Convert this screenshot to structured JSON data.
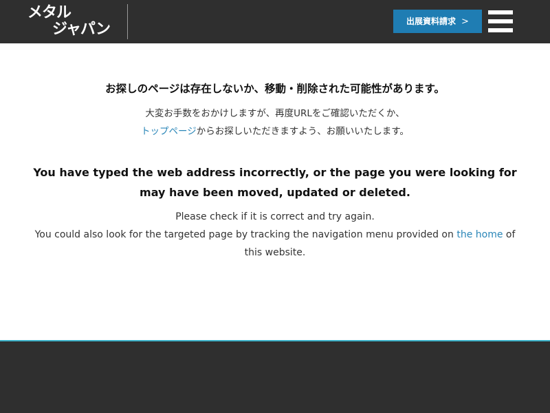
{
  "header": {
    "logo_line1": "メタル",
    "logo_line2": "ジャパン",
    "cta_label": "出展資料請求",
    "cta_chevron": ">",
    "colors": {
      "header_bg": "#2f2f2f",
      "cta_bg": "#1f7db3",
      "text": "#ffffff"
    }
  },
  "main": {
    "jp_heading": "お探しのページは存在しないか、移動・削除された可能性があります。",
    "jp_line1": "大変お手数をおかけしますが、再度URLをご確認いただくか、",
    "jp_link": "トップページ",
    "jp_line2_rest": "からお探しいただきますよう、お願いいたします。",
    "en_heading": "You have typed the web address incorrectly, or the page you were looking for may have been moved, updated or deleted.",
    "en_line1": "Please check if it is correct and try again.",
    "en_line2_pre": "You could also look for the targeted page by tracking the navigation menu provided on ",
    "en_link": "the home",
    "en_line2_post": " of this website.",
    "colors": {
      "link": "#2a86b8"
    }
  },
  "footer": {
    "colors": {
      "border": "#3ab0c8",
      "bg": "#2f2f2f"
    }
  }
}
